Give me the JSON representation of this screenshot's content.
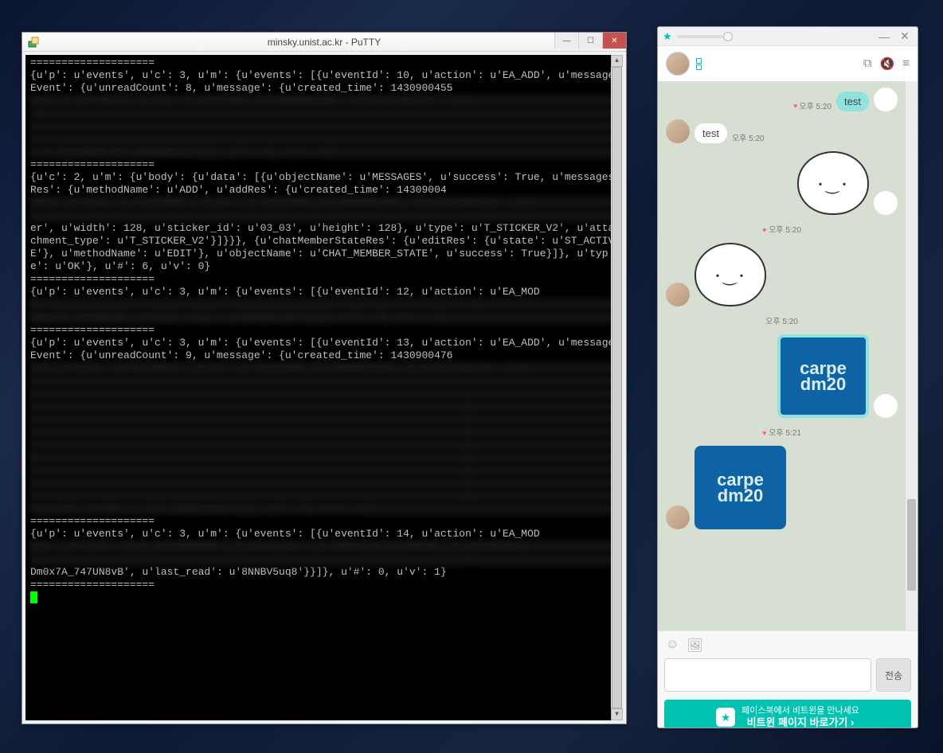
{
  "putty": {
    "title": "minsky.unist.ac.kr - PuTTY",
    "lines": [
      {
        "t": "====================",
        "b": false
      },
      {
        "t": "{u'p': u'events', u'c': 3, u'm': {u'events': [{u'eventId': 10, u'action': u'EA_ADD', u'messageEvent': {u'unreadCount': 8, u'message': {u'created_time': 1430900455",
        "b": false
      },
      {
        "t": "522, u'747:N8v2', u'id': u'7344FM02_227_8NNB5KCK8', u'attachments': [{u",
        "b": true
      },
      {
        "t": "'s...                                                                  ",
        "b": true
      },
      {
        "t": "'...':                                                                  ",
        "b": true
      },
      {
        "t": "'...':                                                                  ",
        "b": true
      },
      {
        "t": ": u'7344FM02_227_8NNB5KCK8'}]}, u'#': 0, u'v': 1}",
        "b": true
      },
      {
        "t": "====================",
        "b": false
      },
      {
        "t": "{u'c': 2, u'm': {u'body': {u'data': [{u'objectName': u'MESSAGES', u'success': True, u'messagesRes': {u'methodName': u'ADD', u'addRes': {u'created_time': 14309004",
        "b": false
      },
      {
        "t": "5597, u'from': u'7344FM02', u'id': u'7344FM02_227_8NNB5KjD8', u'attachments': [{u",
        "b": true
      },
      {
        "t": "'...                                                                  ",
        "b": true
      },
      {
        "t": "er', u'width': 128, u'sticker_id': u'03_03', u'height': 128}, u'type': u'T_STICKER_V2', u'attachment_type': u'T_STICKER_V2'}]}}}, {u'chatMemberStateRes': {u'editRes': {u'state': u'ST_ACTIVE'}, u'methodName': u'EDIT'}, u'objectName': u'CHAT_MEMBER_STATE', u'success': True}]}, u'type': u'OK'}, u'#': 6, u'v': 0}",
        "b": false
      },
      {
        "t": "====================",
        "b": false
      },
      {
        "t": "{u'p': u'events', u'c': 3, u'm': {u'events': [{u'eventId': 12, u'action': u'EA_MOD",
        "b": false
      },
      {
        "t": "E...                                                                   4",
        "b": true
      },
      {
        "t": "Dm0x7A_747UN8vB', u'last_read': u'8NNB5KjD8'}}]}, u'#': 0, u'v': 1}",
        "b": true
      },
      {
        "t": "====================",
        "b": false
      },
      {
        "t": "{u'p': u'events', u'c': 3, u'm': {u'events': [{u'eventId': 13, u'action': u'EA_ADD', u'messageEvent': {u'unreadCount': 9, u'message': {u'created_time': 1430900476",
        "b": false
      },
      {
        "t": "275, u'from': u'747oN8v2', u'id': u'7344FM02_227_8NNBV32X8', u'attachments': [{u'",
        "b": true
      },
      {
        "t": "'...                                                                 ",
        "b": true
      },
      {
        "t": "s...                                                                 ",
        "b": true
      },
      {
        "t": "'...                                                                  h",
        "b": true
      },
      {
        "t": "'...                                                                  7",
        "b": true
      },
      {
        "t": "'...                                                                  /",
        "b": true
      },
      {
        "t": "'...                                                                  n",
        "b": true
      },
      {
        "t": "N...                                                                  p",
        "b": true
      },
      {
        "t": "'...                                                                  o",
        "b": true
      },
      {
        "t": "'...                                                                  t",
        "b": true
      },
      {
        "t": "'...                                                                  o",
        "b": true
      },
      {
        "t": "bjectId': u'fb_..._227_8NNBV32X8'}]}, u'#': 0, u'v': 1}",
        "b": true
      },
      {
        "t": "====================",
        "b": false
      },
      {
        "t": "{u'p': u'events', u'c': 3, u'm': {u'events': [{u'eventId': 14, u'action': u'EA_MOD",
        "b": false
      },
      {
        "t": "IFY', u'from': u'ST_CHATMEMBER', u'objectId': u'74Dmox7A_747oN8vB', u'chatMember",
        "b": true
      },
      {
        "t": "...                                                                   4",
        "b": true
      },
      {
        "t": "Dm0x7A_747UN8vB', u'last_read': u'8NNBV5uq8'}}]}, u'#': 0, u'v': 1}",
        "b": false
      },
      {
        "t": "====================",
        "b": false
      }
    ]
  },
  "chat": {
    "messages": {
      "m1": {
        "text": "test",
        "time": "오후 5:20"
      },
      "m2": {
        "text": "test",
        "time": "오후 5:20"
      },
      "m3_time": "오후 5:20",
      "m4_time": "오후 5:20",
      "m5_time": "오후 5:21"
    },
    "carpe": {
      "l1": "carpe",
      "l2": "dm20"
    },
    "send_label": "전송",
    "banner": {
      "line1": "페이스북에서 비트윈을 만나세요",
      "line2": "비트윈 페이지 바로가기 ›"
    }
  }
}
